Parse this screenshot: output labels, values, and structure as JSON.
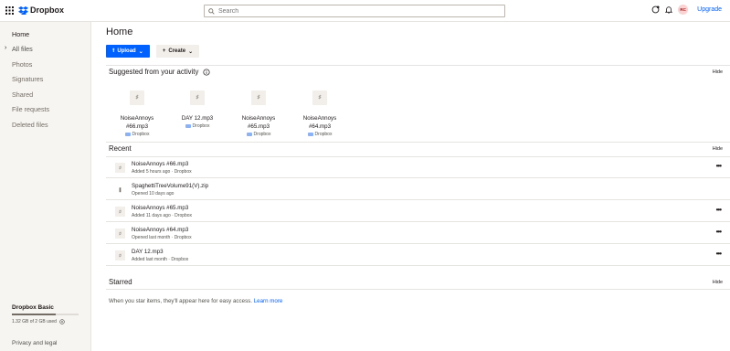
{
  "brand": {
    "name": "Dropbox"
  },
  "search": {
    "placeholder": "Search"
  },
  "topbar": {
    "avatar_initials": "RC",
    "upgrade_label": "Upgrade"
  },
  "sidebar": {
    "items": [
      {
        "label": "Home"
      },
      {
        "label": "All files"
      },
      {
        "label": "Photos"
      },
      {
        "label": "Signatures"
      },
      {
        "label": "Shared"
      },
      {
        "label": "File requests"
      },
      {
        "label": "Deleted files"
      }
    ],
    "plan_name": "Dropbox Basic",
    "usage_text": "1.32 GB of 2 GB used",
    "usage_fraction": 0.66,
    "privacy_label": "Privacy and legal"
  },
  "main": {
    "title": "Home",
    "upload_label": "Upload",
    "create_label": "Create",
    "suggested": {
      "title": "Suggested from your activity",
      "hide_label": "Hide",
      "cards": [
        {
          "name_line1": "NoiseAnnoys",
          "name_line2": "#66.mp3",
          "location": "Dropbox"
        },
        {
          "name_line1": "DAY 12.mp3",
          "name_line2": "",
          "location": "Dropbox"
        },
        {
          "name_line1": "NoiseAnnoys",
          "name_line2": "#65.mp3",
          "location": "Dropbox"
        },
        {
          "name_line1": "NoiseAnnoys",
          "name_line2": "#64.mp3",
          "location": "Dropbox"
        }
      ]
    },
    "recent": {
      "title": "Recent",
      "hide_label": "Hide",
      "rows": [
        {
          "name": "NoiseAnnoys #66.mp3",
          "meta": "Added 5 hours ago · Dropbox",
          "type": "audio"
        },
        {
          "name": "SpaghettiTreeVolume91(V).zip",
          "meta": "Opened 10 days ago",
          "type": "zip"
        },
        {
          "name": "NoiseAnnoys #65.mp3",
          "meta": "Added 11 days ago · Dropbox",
          "type": "audio"
        },
        {
          "name": "NoiseAnnoys #64.mp3",
          "meta": "Opened last month · Dropbox",
          "type": "audio"
        },
        {
          "name": "DAY 12.mp3",
          "meta": "Added last month · Dropbox",
          "type": "audio"
        }
      ]
    },
    "starred": {
      "title": "Starred",
      "hide_label": "Hide",
      "empty_text": "When you star items, they'll appear here for easy access.",
      "learn_more": "Learn more"
    }
  },
  "colors": {
    "accent": "#0061fe",
    "sidebar_bg": "#f7f5f2"
  }
}
